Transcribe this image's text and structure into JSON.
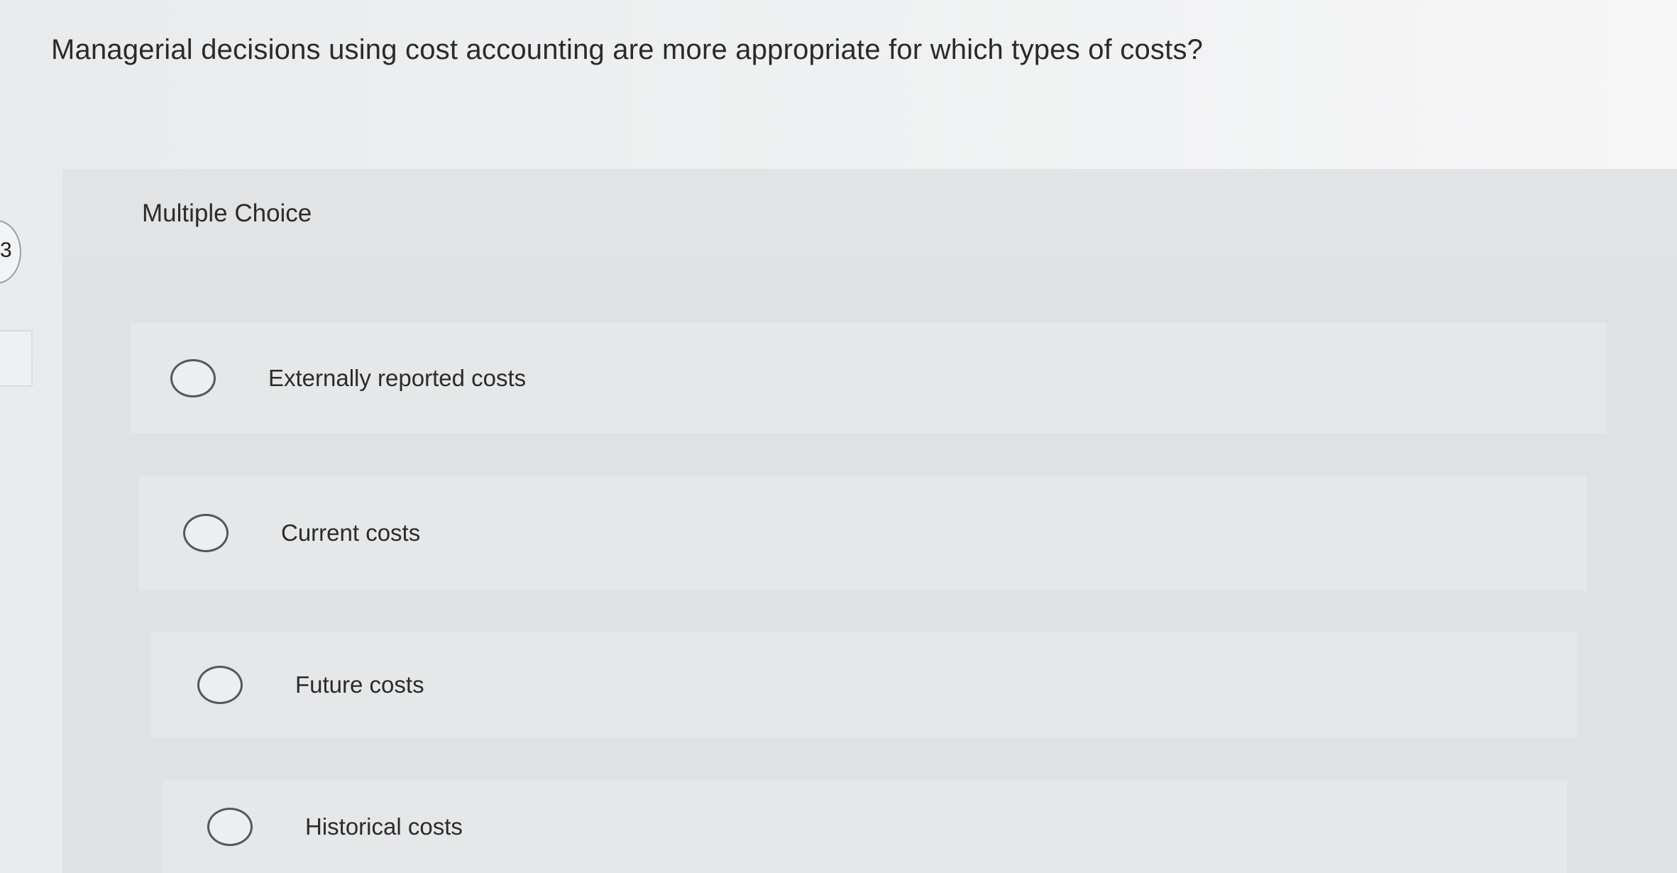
{
  "question": {
    "text": "Managerial decisions using cost accounting are more appropriate for which types of costs?"
  },
  "side_nav": {
    "question_number": "3"
  },
  "multiple_choice": {
    "label": "Multiple Choice",
    "options": [
      {
        "label": "Externally reported costs",
        "selected": false
      },
      {
        "label": "Current costs",
        "selected": false
      },
      {
        "label": "Future costs",
        "selected": false
      },
      {
        "label": "Historical costs",
        "selected": false
      }
    ]
  },
  "colors": {
    "background": "#edeff0",
    "panel": "#dfe1e3",
    "option_row": "#e5e7e9",
    "radio_border": "#53585e",
    "text": "#2b2b2b"
  }
}
